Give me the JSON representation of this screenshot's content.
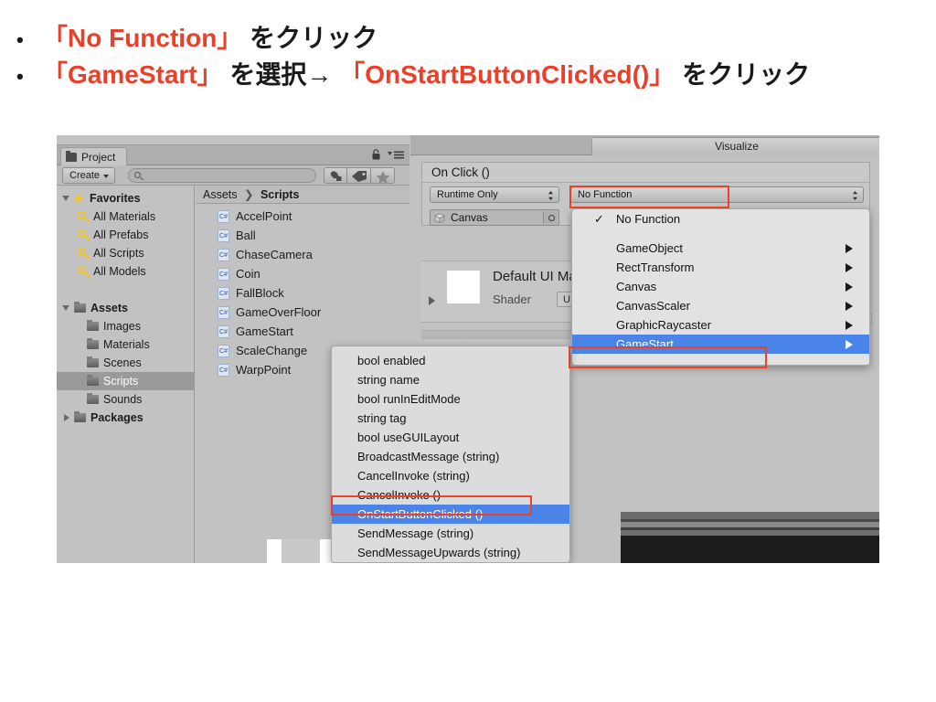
{
  "slide": {
    "bullets": [
      {
        "marker": "•",
        "parts": [
          {
            "text": "「No Function」",
            "color": "red"
          },
          {
            "text": " をクリック",
            "color": "black"
          }
        ]
      },
      {
        "marker": "•",
        "parts": [
          {
            "text": "「GameStart」",
            "color": "red"
          },
          {
            "text": " を選択→ ",
            "color": "black"
          },
          {
            "text": "「OnStartButtonClicked()」",
            "color": "red"
          },
          {
            "text": " をクリック",
            "color": "black"
          }
        ]
      }
    ],
    "accent_color": "#e8412b",
    "text_color": "#1a1a1a"
  },
  "project_window": {
    "tab_label": "Project",
    "tab_icon": "folder-icon",
    "lock_icon": "lock-icon",
    "menu_icon": "hamburger-menu-icon",
    "toolbar": {
      "create_label": "Create",
      "create_caret": "chevron-down-icon",
      "search_placeholder": "",
      "search_value": "",
      "search_icon": "search-icon",
      "filter_icons": [
        "shapes-filter-icon",
        "tag-filter-icon",
        "star-filter-icon"
      ]
    },
    "tree": [
      {
        "label": "Favorites",
        "icon": "star-icon",
        "indent": 0,
        "arrow": "down",
        "bold": true,
        "selected": false
      },
      {
        "label": "All Materials",
        "icon": "search-icon",
        "indent": 1,
        "arrow": "",
        "bold": false,
        "selected": false
      },
      {
        "label": "All Prefabs",
        "icon": "search-icon",
        "indent": 1,
        "arrow": "",
        "bold": false,
        "selected": false
      },
      {
        "label": "All Scripts",
        "icon": "search-icon",
        "indent": 1,
        "arrow": "",
        "bold": false,
        "selected": false
      },
      {
        "label": "All Models",
        "icon": "search-icon",
        "indent": 1,
        "arrow": "",
        "bold": false,
        "selected": false
      },
      {
        "label": "",
        "icon": "",
        "indent": 0,
        "arrow": "",
        "bold": false,
        "selected": false
      },
      {
        "label": "Assets",
        "icon": "folder-icon",
        "indent": 0,
        "arrow": "down",
        "bold": true,
        "selected": false
      },
      {
        "label": "Images",
        "icon": "folder-icon",
        "indent": 1,
        "arrow": "",
        "bold": false,
        "selected": false
      },
      {
        "label": "Materials",
        "icon": "folder-icon",
        "indent": 1,
        "arrow": "",
        "bold": false,
        "selected": false
      },
      {
        "label": "Scenes",
        "icon": "folder-icon",
        "indent": 1,
        "arrow": "",
        "bold": false,
        "selected": false
      },
      {
        "label": "Scripts",
        "icon": "folder-icon",
        "indent": 1,
        "arrow": "",
        "bold": false,
        "selected": true
      },
      {
        "label": "Sounds",
        "icon": "folder-icon",
        "indent": 1,
        "arrow": "",
        "bold": false,
        "selected": false
      },
      {
        "label": "Packages",
        "icon": "folder-icon",
        "indent": 0,
        "arrow": "right",
        "bold": true,
        "selected": false
      }
    ],
    "breadcrumb": {
      "root": "Assets",
      "separator": "❯",
      "current": "Scripts"
    },
    "files": [
      {
        "name": "AccelPoint",
        "icon": "csharp-script-icon",
        "badge": "C#"
      },
      {
        "name": "Ball",
        "icon": "csharp-script-icon",
        "badge": "C#"
      },
      {
        "name": "ChaseCamera",
        "icon": "csharp-script-icon",
        "badge": "C#"
      },
      {
        "name": "Coin",
        "icon": "csharp-script-icon",
        "badge": "C#"
      },
      {
        "name": "FallBlock",
        "icon": "csharp-script-icon",
        "badge": "C#"
      },
      {
        "name": "GameOverFloor",
        "icon": "csharp-script-icon",
        "badge": "C#"
      },
      {
        "name": "GameStart",
        "icon": "csharp-script-icon",
        "badge": "C#"
      },
      {
        "name": "ScaleChange",
        "icon": "csharp-script-icon",
        "badge": "C#"
      },
      {
        "name": "WarpPoint",
        "icon": "csharp-script-icon",
        "badge": "C#"
      }
    ]
  },
  "inspector": {
    "tab_label": "Visualize",
    "onclick_header": "On Click ()",
    "runtime_dropdown": {
      "value": "Runtime Only",
      "icon": "updown-arrows-icon"
    },
    "function_dropdown": {
      "value": "No Function",
      "icon": "updown-arrows-icon"
    },
    "object_field": {
      "value": "Canvas",
      "icon": "prefab-cube-icon",
      "picker_icon": "object-picker-icon"
    },
    "material": {
      "title": "Default UI Mat",
      "shader_label": "Shader",
      "shader_value": "UI/Def",
      "foldout_icon": "triangle-right-icon",
      "swatch_color": "#ffffff"
    },
    "gear_icon": "gear-icon"
  },
  "component_menu": {
    "items": [
      {
        "label": "No Function",
        "checked": true,
        "submenu": false,
        "selected": false
      },
      {
        "label": "GameObject",
        "checked": false,
        "submenu": true,
        "selected": false
      },
      {
        "label": "RectTransform",
        "checked": false,
        "submenu": true,
        "selected": false
      },
      {
        "label": "Canvas",
        "checked": false,
        "submenu": true,
        "selected": false
      },
      {
        "label": "CanvasScaler",
        "checked": false,
        "submenu": true,
        "selected": false
      },
      {
        "label": "GraphicRaycaster",
        "checked": false,
        "submenu": true,
        "selected": false
      },
      {
        "label": "GameStart",
        "checked": false,
        "submenu": true,
        "selected": true
      }
    ],
    "selected_color": "#4a84e8",
    "check_icon": "checkmark-icon",
    "submenu_icon": "triangle-right-icon"
  },
  "method_menu": {
    "items": [
      {
        "label": "bool enabled",
        "selected": false
      },
      {
        "label": "string name",
        "selected": false
      },
      {
        "label": "bool runInEditMode",
        "selected": false
      },
      {
        "label": "string tag",
        "selected": false
      },
      {
        "label": "bool useGUILayout",
        "selected": false
      },
      {
        "label": "BroadcastMessage (string)",
        "selected": false
      },
      {
        "label": "CancelInvoke (string)",
        "selected": false
      },
      {
        "label": "CancelInvoke ()",
        "selected": false
      },
      {
        "label": "OnStartButtonClicked ()",
        "selected": true
      },
      {
        "label": "SendMessage (string)",
        "selected": false
      },
      {
        "label": "SendMessageUpwards (string)",
        "selected": false
      }
    ],
    "selected_color": "#4a84e8"
  },
  "annotations": {
    "highlight_color": "#ea4228",
    "boxes": [
      "no-function-dropdown",
      "gamestart-menu-item",
      "onstartbuttonclicked-menu-item"
    ]
  }
}
